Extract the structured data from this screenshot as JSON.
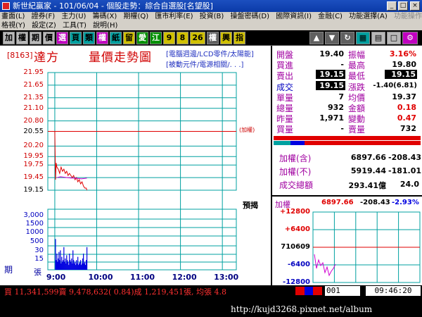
{
  "window": {
    "title": "新世紀贏家 - 101/06/04 - 個股走勢：綜合自選股[名望股]",
    "controls": [
      "_",
      "□",
      "×"
    ]
  },
  "menu": {
    "row1": [
      "畫面(L)",
      "證券(F)",
      "主力(U)",
      "籌碼(X)",
      "期權(Q)",
      "匯市利率(E)",
      "投資(B)",
      "操盤密碼(D)",
      "國際資訊(I)",
      "金融(C)",
      "功能選擇(A)"
    ],
    "row1_disabled": "功能操作(F)",
    "row2": [
      "格視(Y)",
      "設定(Z)",
      "工具(T)",
      "說明(H)"
    ]
  },
  "toolbar": [
    "加",
    "權",
    "期",
    "價",
    "選",
    "頁",
    "類",
    "權",
    "紙",
    "留",
    "愛",
    "江",
    "9",
    "8",
    "26",
    "權",
    "興",
    "指"
  ],
  "stock": {
    "code": "[8163]",
    "name": "達方",
    "chart_title": "量價走勢圖",
    "category1": "[電腦週邊/LCD零件/太陽能]",
    "category2": "[被動元件/電源相關/. . .]"
  },
  "chart_labels": {
    "ji": "期",
    "zhang": "張",
    "jiaquan": "(加權)",
    "yujie": "預揭"
  },
  "quote": {
    "open_label": "開盤",
    "open": "19.40",
    "amp_label": "振幅",
    "amp": "3.16%",
    "buy_label": "買進",
    "buy": "-",
    "high_label": "最高",
    "high": "19.80",
    "sell_label": "賣出",
    "sell": "19.15",
    "low_label": "最低",
    "low": "19.15",
    "deal_label": "成交",
    "deal": "19.15",
    "change_label": "漲跌",
    "change": "-1.40(6.81)",
    "vol_label": "單量",
    "vol": "7",
    "avg_label": "均價",
    "avg": "19.37",
    "total_label": "總量",
    "total": "932",
    "amount_label": "金額",
    "amount": "0.18",
    "yest_label": "昨量",
    "yest": "1,971",
    "var_label": "變動",
    "var": "0.47",
    "bq_label": "買量",
    "bq": "-",
    "sq_label": "賣量",
    "sq": "732"
  },
  "summary": {
    "r1_label": "加權(含)",
    "r1_v1": "6897.66",
    "r1_v2": "-208.43",
    "r2_label": "加權(不)",
    "r2_v1": "5919.44",
    "r2_v2": "-181.01",
    "r3_label": "成交總額",
    "r3_v1": "293.41億",
    "r3_v2": "24.0"
  },
  "mini": {
    "title": "加權",
    "v1": "6897.66",
    "v2": "-208.43",
    "v3": "-2.93%",
    "ylabels": [
      "+12800",
      "+6400",
      "710609",
      "-6400",
      "-12800"
    ]
  },
  "status": {
    "ticker": "買 11,341,599賣 9,478,632( 0.84)成 1,219,451張, 均張 4.8",
    "code": "001",
    "time": "09:46:20"
  },
  "watermark": "http://kujd3268.pixnet.net/album",
  "colors": {
    "price_line": "#e00000",
    "avg_line": "#d000d0",
    "volume_bar": "#0000e0",
    "grid": "#00a0a0",
    "ref_line": "#e00000"
  },
  "chart_data": {
    "type": "line",
    "title": "量價走勢圖",
    "price_axis": [
      "21.95",
      "21.65",
      "21.35",
      "21.10",
      "20.80",
      "20.55",
      "20.20",
      "19.95",
      "19.75",
      "19.45",
      "19.15"
    ],
    "volume_axis": [
      "3,000",
      "1500",
      "1000",
      "500",
      "30",
      "15"
    ],
    "x_ticks": [
      "9:00",
      "10:00",
      "11:00",
      "12:00",
      "13:00"
    ],
    "reference_price": 20.55,
    "price_series": {
      "name": "成交價",
      "x": [
        0,
        1,
        2,
        3,
        5,
        7,
        9,
        11,
        13,
        15,
        17,
        19,
        21,
        23,
        25,
        27,
        29,
        31,
        33,
        35,
        37,
        39,
        41,
        43,
        45,
        46
      ],
      "y": [
        20.55,
        19.4,
        19.8,
        19.7,
        19.65,
        19.55,
        19.7,
        19.6,
        19.65,
        19.55,
        19.6,
        19.5,
        19.55,
        19.5,
        19.45,
        19.5,
        19.4,
        19.45,
        19.35,
        19.4,
        19.3,
        19.35,
        19.25,
        19.2,
        19.2,
        19.15
      ]
    },
    "avg_series": {
      "name": "均價",
      "x": [
        3,
        8,
        13,
        18,
        23,
        28,
        33,
        38,
        43,
        46
      ],
      "y": [
        19.45,
        19.47,
        19.46,
        19.45,
        19.44,
        19.44,
        19.43,
        19.42,
        19.43,
        19.44
      ]
    },
    "volume": {
      "x": [
        1,
        2,
        3,
        4,
        5,
        6,
        7,
        8,
        9,
        10,
        11,
        12,
        13,
        14,
        15,
        16,
        17,
        18,
        19,
        20,
        21,
        22,
        23,
        24,
        25,
        26,
        27,
        28,
        29,
        30,
        31,
        32,
        33,
        34,
        35,
        36,
        37,
        38,
        39,
        40,
        41,
        42,
        43,
        44,
        45,
        46
      ],
      "level": [
        0.95,
        0.3,
        0.5,
        0.25,
        0.35,
        0.55,
        0.3,
        0.6,
        0.2,
        0.4,
        0.25,
        0.3,
        0.7,
        0.25,
        0.35,
        0.2,
        0.45,
        0.3,
        0.25,
        0.15,
        0.5,
        0.3,
        0.25,
        0.35,
        0.2,
        0.6,
        0.3,
        0.2,
        0.25,
        0.15,
        0.3,
        0.2,
        0.4,
        0.15,
        0.2,
        0.25,
        0.3,
        0.15,
        0.2,
        0.35,
        0.5,
        0.2,
        0.25,
        0.15,
        0.3,
        0.7
      ]
    },
    "mini_series": {
      "x": [
        0,
        3,
        6,
        9,
        12,
        15,
        18,
        21,
        24,
        27,
        30
      ],
      "y": [
        -5,
        -15,
        -9,
        -13,
        -11,
        -18,
        -14,
        -20,
        -17,
        -15,
        -12
      ]
    }
  }
}
